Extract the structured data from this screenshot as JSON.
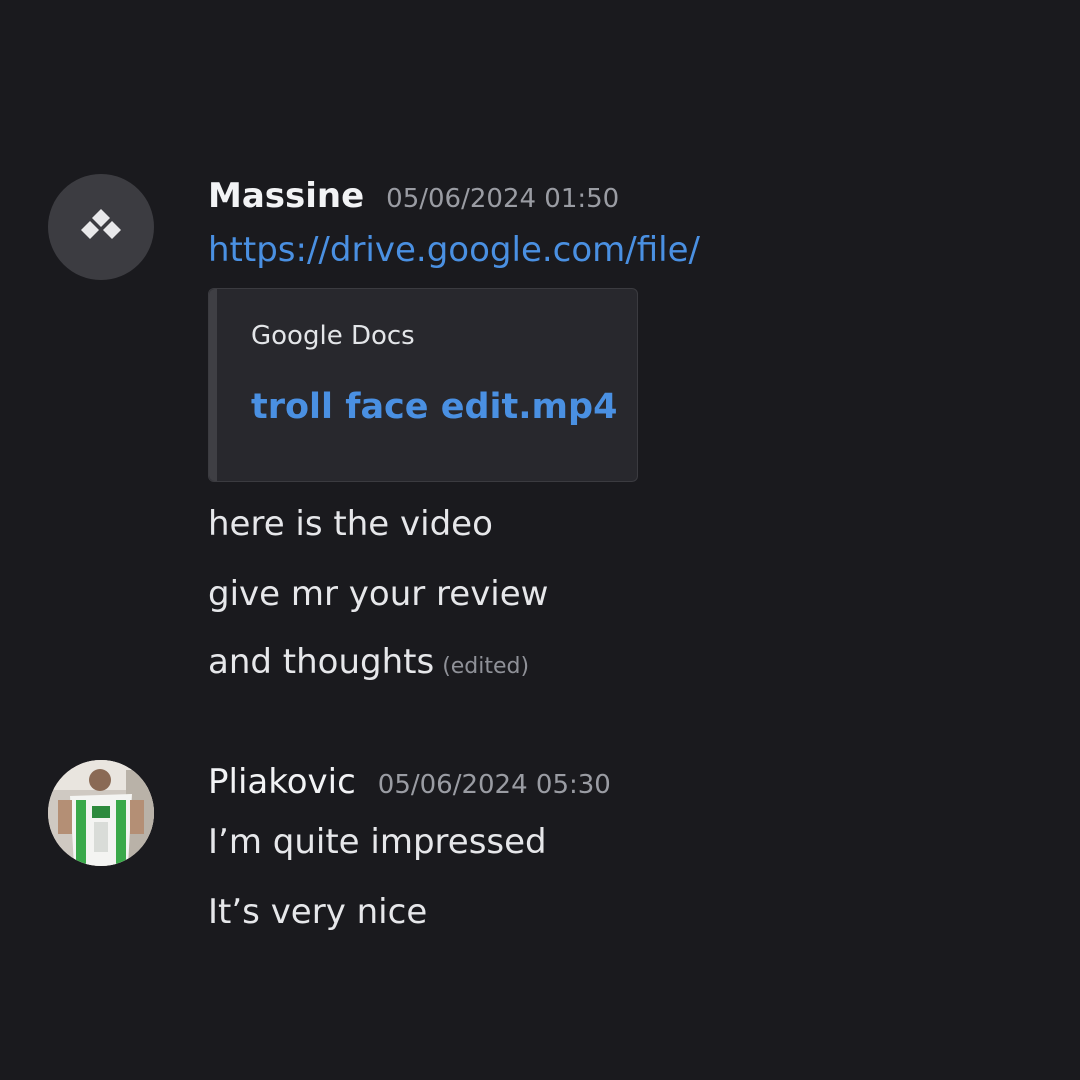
{
  "messages": [
    {
      "username": "Massine",
      "timestamp": "05/06/2024 01:50",
      "link": "https://drive.google.com/file/",
      "embed": {
        "provider": "Google Docs",
        "title": "troll face edit.mp4"
      },
      "lines": [
        "here is the video",
        "give mr your review",
        "and thoughts"
      ],
      "edited_label": "(edited)"
    },
    {
      "username": "Pliakovic",
      "timestamp": "05/06/2024 05:30",
      "lines": [
        "I’m quite impressed",
        "It’s very nice"
      ]
    }
  ],
  "colors": {
    "background": "#1a1a1e",
    "link": "#4a90e2",
    "timestamp": "#9a9ca3",
    "embed_bg": "#28282d"
  }
}
